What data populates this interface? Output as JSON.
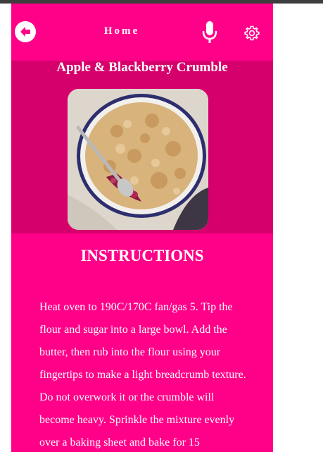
{
  "header": {
    "back_icon": "arrow-left-circle-icon",
    "title": "Home",
    "mic_icon": "microphone-icon",
    "settings_icon": "gear-icon"
  },
  "recipe": {
    "title": "Apple & Blackberry Crumble",
    "image_alt": "crumble-photo"
  },
  "instructions": {
    "heading": "INSTRUCTIONS",
    "text": "Heat oven to 190C/170C fan/gas 5. Tip the flour and sugar into a large bowl. Add the butter, then rub into the flour using your fingertips to make a light breadcrumb texture. Do not overwork it or the crumble will become heavy. Sprinkle the mixture evenly over a baking sheet and bake for 15"
  },
  "colors": {
    "header_bg": "#ff0088",
    "hero_bg": "#d6006c",
    "text": "#ffffff"
  }
}
